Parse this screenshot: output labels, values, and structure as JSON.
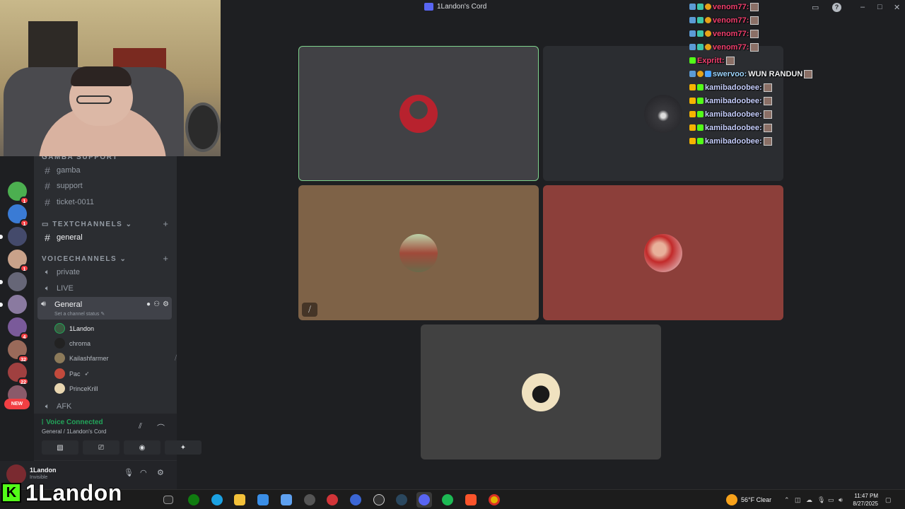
{
  "window": {
    "title": "1Landon's Cord"
  },
  "servers": [
    {
      "name": "server-1",
      "badge": "1",
      "color": "#4caf50"
    },
    {
      "name": "server-2",
      "badge": "1",
      "color": "#3a7bd5"
    },
    {
      "name": "server-3",
      "badge": "",
      "color": "#444a6b"
    },
    {
      "name": "server-4",
      "badge": "1",
      "color": "#c9a28a"
    },
    {
      "name": "server-5",
      "badge": "",
      "color": "#667"
    },
    {
      "name": "server-6",
      "badge": "",
      "color": "#8a7aa0"
    },
    {
      "name": "server-7",
      "badge": "4",
      "color": "#7a5a9a"
    },
    {
      "name": "server-8",
      "badge": "32",
      "color": "#9a6a5a"
    },
    {
      "name": "server-9",
      "badge": "22",
      "color": "#a04040"
    },
    {
      "name": "server-10",
      "badge": "",
      "color": "#8a5a6a"
    }
  ],
  "new_pill": "NEW",
  "sidebar": {
    "category_gamba": "GAMBA SUPPORT",
    "channels_top": [
      "gamba",
      "support",
      "ticket-0011"
    ],
    "category_text": "TEXTCHANNELS",
    "text_general": "general",
    "category_voice": "VOICECHANNELS",
    "voice_channels": [
      "private",
      "LIVE"
    ],
    "active_voice": "General",
    "active_status": "Set a channel status",
    "voice_users": [
      "1Landon",
      "chroma",
      "Kailashfarmer",
      "Pac",
      "PrinceKrill"
    ],
    "afk": "AFK"
  },
  "voice_panel": {
    "connected": "Voice Connected",
    "location": "General / 1Landon's Cord"
  },
  "user_panel": {
    "name": "1Landon",
    "status": "Invisible"
  },
  "grid": {
    "tiles": [
      {
        "user": "1Landon",
        "bg": "#414145",
        "speaking": true,
        "avatar": "#b8222e"
      },
      {
        "user": "chroma",
        "bg": "#2b2d31",
        "speaking": false,
        "avatar": "#2a2a2e"
      },
      {
        "user": "Kailashfarmer",
        "bg": "#7e6247",
        "speaking": false,
        "avatar": "#8c7a5a",
        "muted": true
      },
      {
        "user": "Pac",
        "bg": "#8c3f3a",
        "speaking": false,
        "avatar": "#c24a3c"
      },
      {
        "user": "PrinceKrill",
        "bg": "#414141",
        "speaking": false,
        "avatar": "#e8d6b0"
      }
    ]
  },
  "chat": [
    {
      "user": "venom77:",
      "text": "",
      "color": "#f23f6e"
    },
    {
      "user": "venom77:",
      "text": "",
      "color": "#f23f6e"
    },
    {
      "user": "venom77:",
      "text": "",
      "color": "#f23f6e"
    },
    {
      "user": "venom77:",
      "text": "",
      "color": "#f23f6e"
    },
    {
      "user": "Expritt:",
      "text": "",
      "color": "#f23f6e"
    },
    {
      "user": "swervoo:",
      "text": "WUN RANDUN",
      "color": "#9fd6ff"
    },
    {
      "user": "kamibadoobee:",
      "text": "",
      "color": "#c8d0ff"
    },
    {
      "user": "kamibadoobee:",
      "text": "",
      "color": "#c8d0ff"
    },
    {
      "user": "kamibadoobee:",
      "text": "",
      "color": "#c8d0ff"
    },
    {
      "user": "kamibadoobee:",
      "text": "",
      "color": "#c8d0ff"
    },
    {
      "user": "kamibadoobee:",
      "text": "",
      "color": "#c8d0ff"
    }
  ],
  "taskbar": {
    "weather": "56°F  Clear",
    "time": "11:47 PM",
    "date": "8/27/2025"
  },
  "streamer": {
    "logo": "K",
    "name": "1Landon"
  }
}
